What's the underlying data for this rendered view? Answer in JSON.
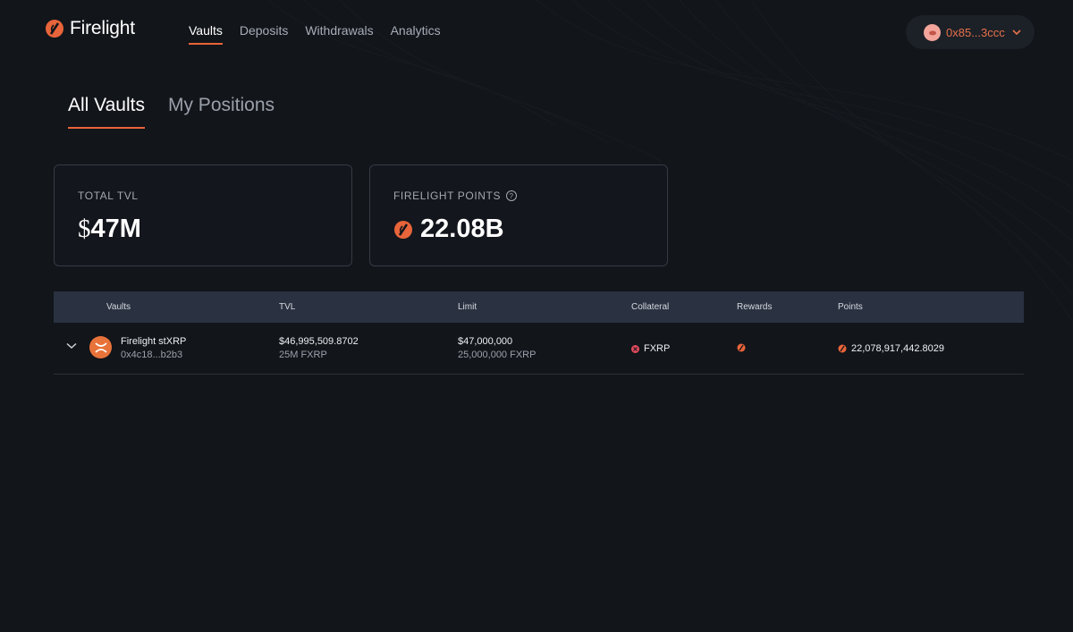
{
  "brand": {
    "name": "Firelight"
  },
  "nav": {
    "items": [
      {
        "label": "Vaults",
        "active": true
      },
      {
        "label": "Deposits",
        "active": false
      },
      {
        "label": "Withdrawals",
        "active": false
      },
      {
        "label": "Analytics",
        "active": false
      }
    ]
  },
  "wallet": {
    "address": "0x85...3ccc",
    "icon": "chevron-down-icon"
  },
  "tabs": [
    {
      "label": "All Vaults",
      "active": true
    },
    {
      "label": "My Positions",
      "active": false
    }
  ],
  "stats": {
    "tvl": {
      "label": "TOTAL TVL",
      "currency": "$",
      "value": "47M"
    },
    "points": {
      "label": "FIRELIGHT POINTS",
      "value": "22.08B",
      "icon": "help-icon"
    }
  },
  "table": {
    "headers": [
      "Vaults",
      "TVL",
      "Limit",
      "Collateral",
      "Rewards",
      "Points"
    ],
    "rows": [
      {
        "name": "Firelight stXRP",
        "address": "0x4c18...b2b3",
        "tvl": "$46,995,509.8702",
        "tvl_sub": "25M FXRP",
        "limit": "$47,000,000",
        "limit_sub": "25,000,000 FXRP",
        "collateral": "FXRP",
        "points": "22,078,917,442.8029"
      }
    ]
  },
  "colors": {
    "accent": "#e8643a",
    "background": "#12151a",
    "header_row": "#2a3140"
  }
}
